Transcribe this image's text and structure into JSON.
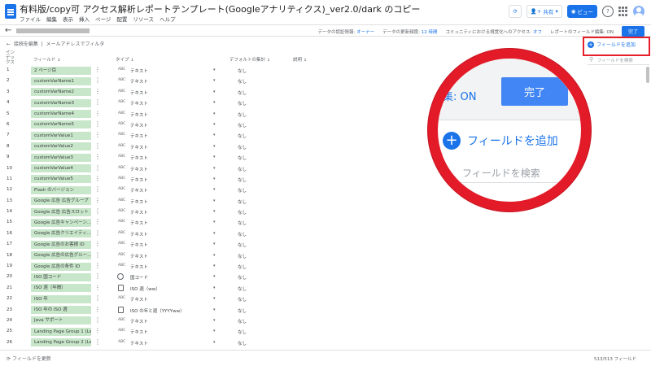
{
  "app": {
    "title": "有料版/copy可 アクセス解析レポートテンプレート(Googleアナリティクス)_ver2.0/dark のコピー",
    "menu": [
      "ファイル",
      "編集",
      "表示",
      "挿入",
      "ページ",
      "配置",
      "リソース",
      "ヘルプ"
    ],
    "share_label": "共有",
    "view_label": "ビュー"
  },
  "datasource_bar": {
    "credentials_label": "データの認証情報:",
    "credentials_value": "オーナー",
    "freshness_label": "データの更新頻度:",
    "freshness_value": "12 時間",
    "community_label": "コミュニティにおける視覚化へのアクセス:",
    "community_value": "オフ",
    "report_edit_label": "レポートのフィールド編集:",
    "report_edit_value": "ON",
    "done_label": "完了"
  },
  "toolbar": {
    "edit_connection": "接続を編集",
    "filter_by_email": "メールアドレスでフィルタ",
    "add_field": "フィールドを追加",
    "field_search_placeholder": "フィールドを検索"
  },
  "table": {
    "headers": {
      "index": "インデックス",
      "field": "フィールド",
      "type": "タイプ",
      "default_agg": "デフォルトの集計",
      "description": "説明"
    },
    "rows": [
      {
        "idx": "1",
        "field": "2 ページ目",
        "type_icon": "ABC",
        "type": "テキスト",
        "agg": "なし"
      },
      {
        "idx": "2",
        "field": "customVarName1",
        "type_icon": "ABC",
        "type": "テキスト",
        "agg": "なし"
      },
      {
        "idx": "3",
        "field": "customVarName2",
        "type_icon": "ABC",
        "type": "テキスト",
        "agg": "なし"
      },
      {
        "idx": "4",
        "field": "customVarName3",
        "type_icon": "ABC",
        "type": "テキスト",
        "agg": "なし"
      },
      {
        "idx": "5",
        "field": "customVarName4",
        "type_icon": "ABC",
        "type": "テキスト",
        "agg": "なし"
      },
      {
        "idx": "6",
        "field": "customVarName5",
        "type_icon": "ABC",
        "type": "テキスト",
        "agg": "なし"
      },
      {
        "idx": "7",
        "field": "customVarValue1",
        "type_icon": "ABC",
        "type": "テキスト",
        "agg": "なし"
      },
      {
        "idx": "8",
        "field": "customVarValue2",
        "type_icon": "ABC",
        "type": "テキスト",
        "agg": "なし"
      },
      {
        "idx": "9",
        "field": "customVarValue3",
        "type_icon": "ABC",
        "type": "テキスト",
        "agg": "なし"
      },
      {
        "idx": "10",
        "field": "customVarValue4",
        "type_icon": "ABC",
        "type": "テキスト",
        "agg": "なし"
      },
      {
        "idx": "11",
        "field": "customVarValue5",
        "type_icon": "ABC",
        "type": "テキスト",
        "agg": "なし"
      },
      {
        "idx": "12",
        "field": "Flash のバージョン",
        "type_icon": "ABC",
        "type": "テキスト",
        "agg": "なし"
      },
      {
        "idx": "13",
        "field": "Google 広告 広告グループ",
        "type_icon": "ABC",
        "type": "テキスト",
        "agg": "なし"
      },
      {
        "idx": "14",
        "field": "Google 広告 広告スロット",
        "type_icon": "ABC",
        "type": "テキスト",
        "agg": "なし"
      },
      {
        "idx": "15",
        "field": "Google 広告キャンペーン...",
        "type_icon": "ABC",
        "type": "テキスト",
        "agg": "なし"
      },
      {
        "idx": "16",
        "field": "Google 広告クリエイティ...",
        "type_icon": "ABC",
        "type": "テキスト",
        "agg": "なし"
      },
      {
        "idx": "17",
        "field": "Google 広告のお客様 ID",
        "type_icon": "ABC",
        "type": "テキスト",
        "agg": "なし"
      },
      {
        "idx": "18",
        "field": "Google 広告の広告グルー...",
        "type_icon": "ABC",
        "type": "テキスト",
        "agg": "なし"
      },
      {
        "idx": "19",
        "field": "Google 広告の条件 ID",
        "type_icon": "ABC",
        "type": "テキスト",
        "agg": "なし"
      },
      {
        "idx": "20",
        "field": "ISO 国コード",
        "type_icon": "globe",
        "type": "国コード",
        "agg": "なし"
      },
      {
        "idx": "21",
        "field": "ISO 週（年間）",
        "type_icon": "calendar",
        "type": "ISO 週（ww）",
        "agg": "なし"
      },
      {
        "idx": "22",
        "field": "ISO 年",
        "type_icon": "ABC",
        "type": "テキスト",
        "agg": "なし"
      },
      {
        "idx": "23",
        "field": "ISO 年の ISO 週",
        "type_icon": "calendar",
        "type": "ISO の年と週（YYYYww）",
        "agg": "なし"
      },
      {
        "idx": "24",
        "field": "Java サポート",
        "type_icon": "ABC",
        "type": "テキスト",
        "agg": "なし"
      },
      {
        "idx": "25",
        "field": "Landing Page Group 1 (La...",
        "type_icon": "ABC",
        "type": "テキスト",
        "agg": "なし"
      },
      {
        "idx": "26",
        "field": "Landing Page Group 2 (La...",
        "type_icon": "ABC",
        "type": "テキスト",
        "agg": "なし"
      }
    ]
  },
  "footer": {
    "refresh_fields": "フィールドを更新",
    "field_count": "513/513 フィールド"
  },
  "magnifier": {
    "on_text": "集: ON",
    "done_text": "完了",
    "add_field_text": "フィールドを追加",
    "search_text": "フィールドを検索"
  },
  "colors": {
    "accent": "#1a73e8",
    "field_chip": "#c8e6c9",
    "highlight_red": "#e31b29"
  }
}
